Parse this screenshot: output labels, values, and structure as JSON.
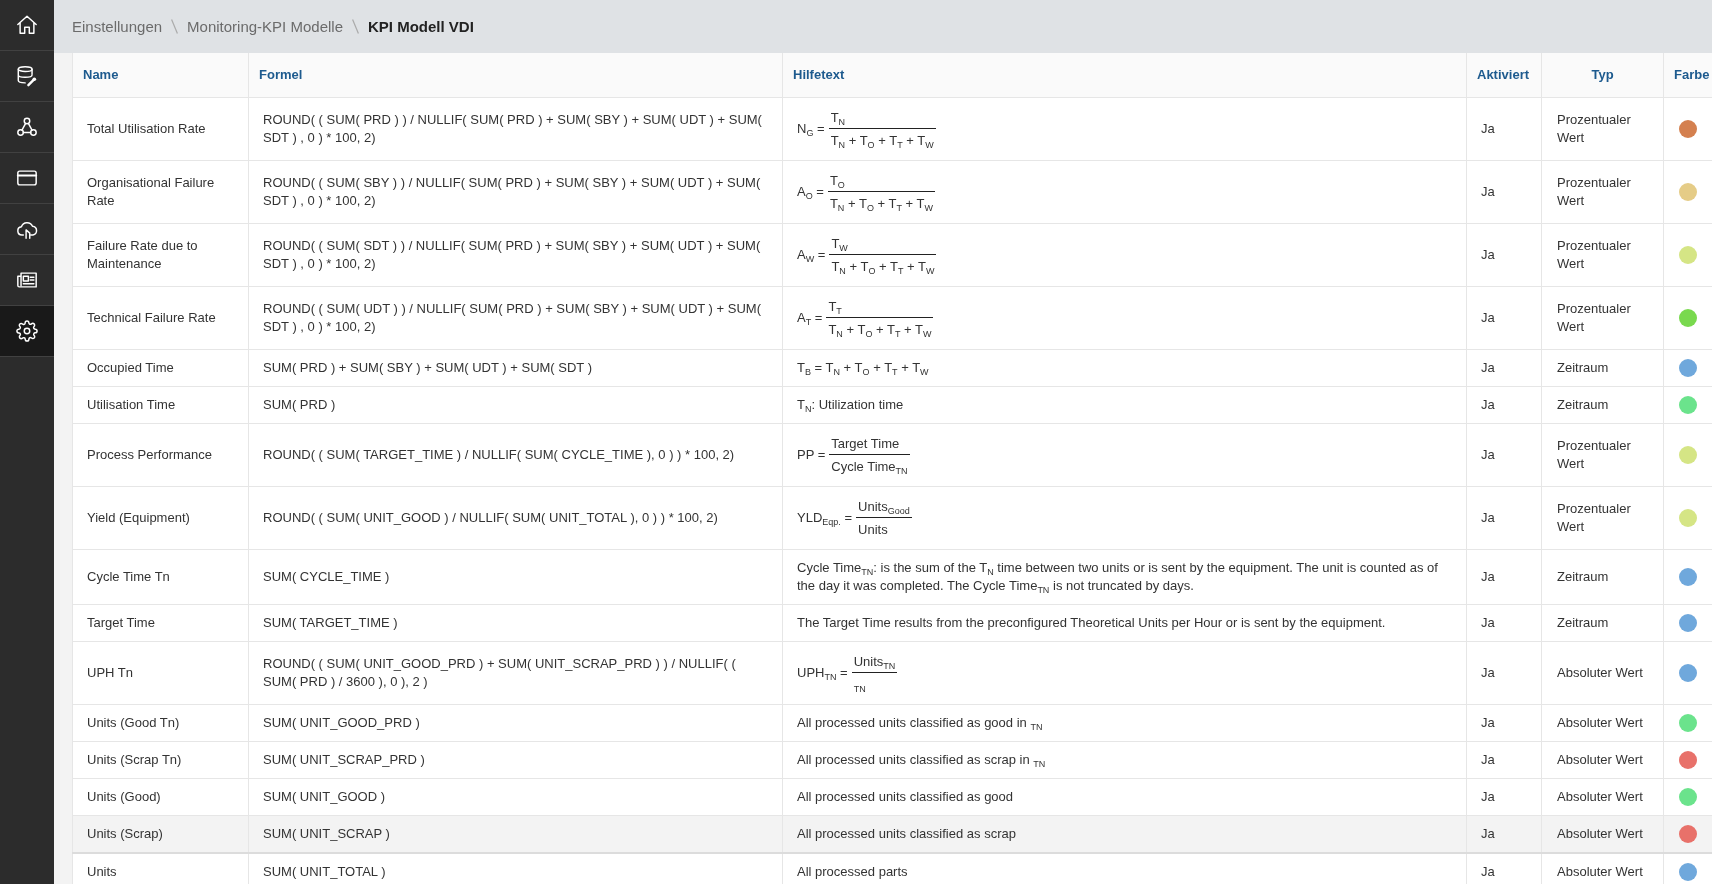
{
  "sidebar": {
    "items": [
      {
        "selected": false
      },
      {
        "selected": false
      },
      {
        "selected": false
      },
      {
        "selected": false
      },
      {
        "selected": false
      },
      {
        "selected": false
      },
      {
        "selected": true
      }
    ]
  },
  "breadcrumb": [
    {
      "label": "Einstellungen",
      "current": false
    },
    {
      "label": "Monitoring-KPI Modelle",
      "current": false
    },
    {
      "label": "KPI Modell VDI",
      "current": true
    }
  ],
  "table": {
    "columns": [
      "Name",
      "Formel",
      "Hilfetext",
      "Aktiviert",
      "Typ",
      "Farbe"
    ],
    "rows": [
      {
        "name": "Total Utilisation Rate",
        "formula": "ROUND( ( SUM( PRD ) ) / NULLIF( SUM( PRD ) + SUM( SBY ) + SUM( UDT ) + SUM( SDT ) , 0 ) * 100, 2)",
        "help": {
          "kind": "fraction",
          "lhs": "N$_{G}$ =",
          "numerator": "T$_{N}$",
          "denominator": "T$_{N}$ + T$_{O}$ + T$_{T}$ + T$_{W}$"
        },
        "activated": "Ja",
        "type": "Prozentualer Wert",
        "color": "#d4804f",
        "highlighted": false
      },
      {
        "name": "Organisational Failure Rate",
        "formula": "ROUND( ( SUM( SBY ) ) / NULLIF( SUM( PRD ) + SUM( SBY ) + SUM( UDT ) + SUM( SDT ) , 0 ) * 100, 2)",
        "help": {
          "kind": "fraction",
          "lhs": "A$_{O}$ =",
          "numerator": "T$_{O}$",
          "denominator": "T$_{N}$ + T$_{O}$ + T$_{T}$ + T$_{W}$"
        },
        "activated": "Ja",
        "type": "Prozentualer Wert",
        "color": "#e5cc87",
        "highlighted": false
      },
      {
        "name": "Failure Rate due to Maintenance",
        "formula": "ROUND( ( SUM( SDT ) ) / NULLIF( SUM( PRD ) + SUM( SBY ) + SUM( UDT ) + SUM( SDT ) , 0 ) * 100, 2)",
        "help": {
          "kind": "fraction",
          "lhs": "A$_{W}$ =",
          "numerator": "T$_{W}$",
          "denominator": "T$_{N}$ + T$_{O}$ + T$_{T}$ + T$_{W}$"
        },
        "activated": "Ja",
        "type": "Prozentualer Wert",
        "color": "#d5e585",
        "highlighted": false
      },
      {
        "name": "Technical Failure Rate",
        "formula": "ROUND( ( SUM( UDT ) ) / NULLIF( SUM( PRD ) + SUM( SBY ) + SUM( UDT ) + SUM( SDT ) , 0 ) * 100, 2)",
        "help": {
          "kind": "fraction",
          "lhs": "A$_{T}$ =",
          "numerator": "T$_{T}$",
          "denominator": "T$_{N}$ + T$_{O}$ + T$_{T}$ + T$_{W}$"
        },
        "activated": "Ja",
        "type": "Prozentualer Wert",
        "color": "#79d94e",
        "highlighted": false
      },
      {
        "name": "Occupied Time",
        "formula": "SUM( PRD ) + SUM( SBY ) + SUM( UDT ) + SUM( SDT )",
        "help": {
          "kind": "text",
          "text": "T$_{B}$ = T$_{N}$ + T$_{O}$ + T$_{T}$ + T$_{W}$"
        },
        "activated": "Ja",
        "type": "Zeitraum",
        "color": "#6fa8dc",
        "highlighted": false
      },
      {
        "name": "Utilisation Time",
        "formula": "SUM( PRD )",
        "help": {
          "kind": "text",
          "text": "T$_{N}$: Utilization time"
        },
        "activated": "Ja",
        "type": "Zeitraum",
        "color": "#6be38c",
        "highlighted": false
      },
      {
        "name": "Process Performance",
        "formula": "ROUND( ( SUM( TARGET_TIME ) / NULLIF( SUM( CYCLE_TIME ), 0 ) ) * 100, 2)",
        "help": {
          "kind": "fraction",
          "lhs": "PP =",
          "numerator": "Target Time",
          "denominator": "Cycle Time$_{TN}$"
        },
        "activated": "Ja",
        "type": "Prozentualer Wert",
        "color": "#d5e585",
        "highlighted": false
      },
      {
        "name": "Yield (Equipment)",
        "formula": "ROUND( ( SUM( UNIT_GOOD ) / NULLIF( SUM( UNIT_TOTAL ), 0 ) ) * 100, 2)",
        "help": {
          "kind": "fraction",
          "lhs": "YLD$_{Eqp.}$ =",
          "numerator": "Units$_{Good}$",
          "denominator": "Units"
        },
        "activated": "Ja",
        "type": "Prozentualer Wert",
        "color": "#d5e585",
        "highlighted": false
      },
      {
        "name": "Cycle Time Tn",
        "formula": "SUM( CYCLE_TIME )",
        "help": {
          "kind": "text",
          "text": "Cycle Time$_{TN}$: is the sum of the T$_{N}$ time between two units or is sent by the equipment. The unit is counted as of the day it was completed. The Cycle Time$_{TN}$ is not truncated by days."
        },
        "activated": "Ja",
        "type": "Zeitraum",
        "color": "#6fa8dc",
        "highlighted": false
      },
      {
        "name": "Target Time",
        "formula": "SUM( TARGET_TIME )",
        "help": {
          "kind": "text",
          "text": "The Target Time results from the preconfigured Theoretical Units per Hour or is sent by the equipment."
        },
        "activated": "Ja",
        "type": "Zeitraum",
        "color": "#6fa8dc",
        "highlighted": false
      },
      {
        "name": "UPH Tn",
        "formula": "ROUND( ( SUM( UNIT_GOOD_PRD ) + SUM( UNIT_SCRAP_PRD ) ) / NULLIF( ( SUM( PRD ) / 3600 ), 0 ), 2 )",
        "help": {
          "kind": "fraction",
          "lhs": "UPH$_{TN}$ =",
          "numerator": "Units$_{TN}$",
          "denominator": "$_{TN}$"
        },
        "activated": "Ja",
        "type": "Absoluter Wert",
        "color": "#6fa8dc",
        "highlighted": false
      },
      {
        "name": "Units (Good Tn)",
        "formula": "SUM( UNIT_GOOD_PRD )",
        "help": {
          "kind": "text",
          "text": "All processed units classified as good in $_{TN}$"
        },
        "activated": "Ja",
        "type": "Absoluter Wert",
        "color": "#6be38c",
        "highlighted": false
      },
      {
        "name": "Units (Scrap Tn)",
        "formula": "SUM( UNIT_SCRAP_PRD )",
        "help": {
          "kind": "text",
          "text": "All processed units classified as scrap in $_{TN}$"
        },
        "activated": "Ja",
        "type": "Absoluter Wert",
        "color": "#e8716a",
        "highlighted": false
      },
      {
        "name": "Units (Good)",
        "formula": "SUM( UNIT_GOOD )",
        "help": {
          "kind": "text",
          "text": "All processed units classified as good"
        },
        "activated": "Ja",
        "type": "Absoluter Wert",
        "color": "#6be38c",
        "highlighted": false
      },
      {
        "name": "Units (Scrap)",
        "formula": "SUM( UNIT_SCRAP )",
        "help": {
          "kind": "text",
          "text": "All processed units classified as scrap"
        },
        "activated": "Ja",
        "type": "Absoluter Wert",
        "color": "#e8716a",
        "highlighted": true
      },
      {
        "name": "Units",
        "formula": "SUM( UNIT_TOTAL )",
        "help": {
          "kind": "text",
          "text": "All processed parts"
        },
        "activated": "Ja",
        "type": "Absoluter Wert",
        "color": "#6fa8dc",
        "highlighted": false
      }
    ]
  }
}
